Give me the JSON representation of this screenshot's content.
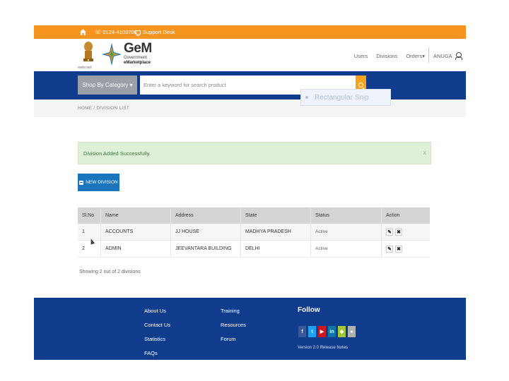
{
  "topbar": {
    "phone": "0124-4103700",
    "support": "Support Desk"
  },
  "header": {
    "emblem_caption": "सत्यमेव जयते",
    "logo_title": "GeM",
    "logo_sub1": "Government",
    "logo_sub2": "eMarketplace",
    "nav": [
      "Users",
      "Divisions",
      "Orders▾"
    ],
    "username": "ANUGA"
  },
  "search": {
    "category_label": "Shop By Category ▾",
    "placeholder": "Enter a keyword for search product"
  },
  "breadcrumb": "HOME / DIVISION LIST",
  "overlay": {
    "label": "Rectangular Snip"
  },
  "alert": {
    "message": "Division Added Successfully.",
    "close": "x"
  },
  "new_division_label": "NEW DIVISION",
  "table": {
    "headers": [
      "Sl.No",
      "Name",
      "Address",
      "State",
      "Status",
      "Action"
    ],
    "rows": [
      {
        "no": "1",
        "name": "ACCOUNTS",
        "address": "JJ HOUSE",
        "state": "MADHYA PRADESH",
        "status": "Active"
      },
      {
        "no": "2",
        "name": "ADMIN",
        "address": "JEEVANTARA BUILDING",
        "state": "DELHI",
        "status": "Active"
      }
    ],
    "edit_glyph": "✎",
    "delete_glyph": "✖"
  },
  "count_text": "Showing 2 out of 2 divisions",
  "footer": {
    "col1": [
      "About Us",
      "Contact Us",
      "Statistics",
      "FAQs"
    ],
    "col2": [
      "Training",
      "Resources",
      "Forum"
    ],
    "follow_title": "Follow",
    "social": [
      {
        "name": "facebook-icon",
        "glyph": "f",
        "color": "#3b5998"
      },
      {
        "name": "twitter-icon",
        "glyph": "t",
        "color": "#1da1f2"
      },
      {
        "name": "youtube-icon",
        "glyph": "▶",
        "color": "#cc181e"
      },
      {
        "name": "linkedin-icon",
        "glyph": "in",
        "color": "#0e76a8"
      },
      {
        "name": "android-icon",
        "glyph": "◆",
        "color": "#a4c639"
      },
      {
        "name": "apple-icon",
        "glyph": "●",
        "color": "#b0b0b0"
      }
    ],
    "version": "Version 2.0 Release Notes"
  },
  "colors": {
    "orange": "#f7941d",
    "navy": "#0f3c8c",
    "blue_button": "#1b75bc",
    "success_bg": "#dff0d8"
  }
}
